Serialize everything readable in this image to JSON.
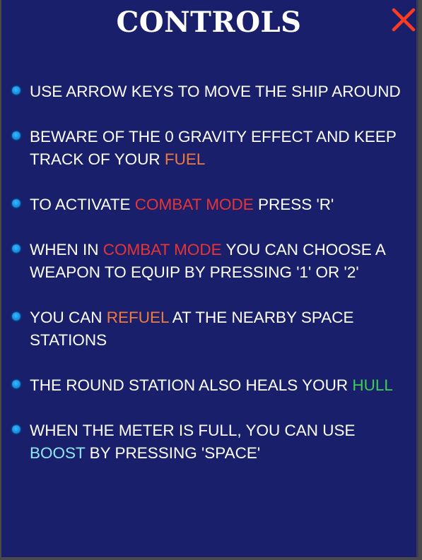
{
  "title": "CONTROLS",
  "close_icon": "close-icon",
  "colors": {
    "background": "#1a1f6b",
    "highlight_orange": "#f07a3c",
    "highlight_red": "#e53535",
    "highlight_green": "#3ccf52",
    "highlight_cyan": "#8ee8f5",
    "bullet": "#1591e8",
    "close": "#ff3b1f"
  },
  "items": [
    {
      "parts": [
        {
          "text": "USE ARROW KEYS TO MOVE THE SHIP AROUND"
        }
      ]
    },
    {
      "parts": [
        {
          "text": "BEWARE OF THE 0 GRAVITY EFFECT AND KEEP TRACK OF YOUR "
        },
        {
          "text": "FUEL",
          "color": "orange"
        }
      ]
    },
    {
      "parts": [
        {
          "text": "TO ACTIVATE "
        },
        {
          "text": "COMBAT MODE",
          "color": "red"
        },
        {
          "text": " PRESS 'R'"
        }
      ]
    },
    {
      "parts": [
        {
          "text": "WHEN IN "
        },
        {
          "text": "COMBAT MODE",
          "color": "red"
        },
        {
          "text": " YOU CAN CHOOSE A WEAPON TO EQUIP BY PRESSING '1' OR '2'"
        }
      ]
    },
    {
      "parts": [
        {
          "text": "YOU CAN "
        },
        {
          "text": "REFUEL",
          "color": "orange"
        },
        {
          "text": " AT THE NEARBY SPACE STATIONS"
        }
      ]
    },
    {
      "parts": [
        {
          "text": "THE ROUND STATION ALSO HEALS YOUR "
        },
        {
          "text": "HULL",
          "color": "green"
        }
      ]
    },
    {
      "parts": [
        {
          "text": "WHEN THE METER IS FULL, YOU CAN USE "
        },
        {
          "text": "BOOST",
          "color": "cyan"
        },
        {
          "text": " BY PRESSING 'SPACE'"
        }
      ]
    }
  ]
}
